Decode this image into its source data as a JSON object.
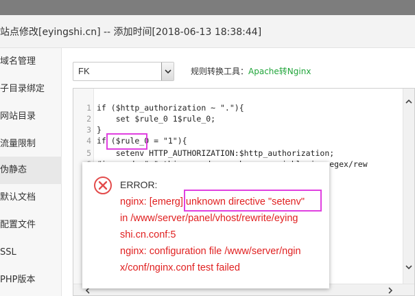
{
  "window": {
    "title": "站点修改[eyingshi.cn] -- 添加时间[2018-06-13 18:38:44]"
  },
  "sidebar": {
    "items": [
      {
        "label": "域名管理"
      },
      {
        "label": "子目录绑定"
      },
      {
        "label": "网站目录"
      },
      {
        "label": "流量限制"
      },
      {
        "label": "伪静态",
        "active": true
      },
      {
        "label": "默认文档"
      },
      {
        "label": "配置文件"
      },
      {
        "label": "SSL"
      },
      {
        "label": "PHP版本"
      }
    ]
  },
  "rewrite": {
    "template_select": {
      "value": "FK"
    },
    "tool_label": "规则转换工具：",
    "tool_link": "Apache转Nginx"
  },
  "editor": {
    "lines": [
      {
        "no": "1",
        "text": "if ($http_authorization ~ \".\"){"
      },
      {
        "no": "2",
        "text": "    set $rule_0 1$rule_0;"
      },
      {
        "no": "3",
        "text": "}"
      },
      {
        "no": "4",
        "text": "if ($rule_0 = \"1\"){"
      },
      {
        "no": "5",
        "text": "    setenv HTTP_AUTHORIZATION:$http_authorization;"
      },
      {
        "no": "6",
        "text": "#ignored: \"-\" thing used or unknown variable in regex/rew"
      }
    ]
  },
  "error_dialog": {
    "title": "ERROR:",
    "lines": [
      "nginx: [emerg] unknown directive \"setenv\"",
      "in /www/server/panel/vhost/rewrite/eying",
      "shi.cn.conf:5",
      "nginx: configuration file /www/server/ngin",
      "x/conf/nginx.conf test failed"
    ]
  },
  "colors": {
    "error_text": "#e02020",
    "link_green": "#20a53a",
    "highlight_box": "#e040e0"
  }
}
